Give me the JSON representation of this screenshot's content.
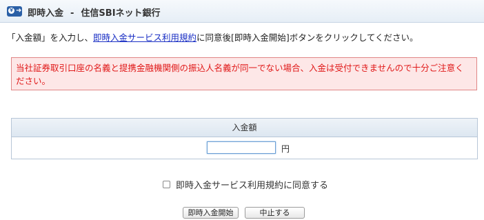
{
  "header": {
    "title": "即時入金",
    "separator": "-",
    "bank": "住信SBIネット銀行",
    "icon": "yen-transfer-icon"
  },
  "instruction": {
    "before": "「入金額」を入力し、",
    "link": "即時入金サービス利用規約",
    "after": "に同意後[即時入金開始]ボタンをクリックしてください。"
  },
  "warning": {
    "text": "当社証券取引口座の名義と提携金融機関側の振込人名義が同一でない場合、入金は受付できませんので十分ご注意ください。"
  },
  "amount": {
    "header": "入金額",
    "value": "",
    "unit": "円"
  },
  "agreement": {
    "label": "即時入金サービス利用規約に同意する",
    "checked": false
  },
  "buttons": {
    "start": "即時入金開始",
    "cancel": "中止する"
  }
}
